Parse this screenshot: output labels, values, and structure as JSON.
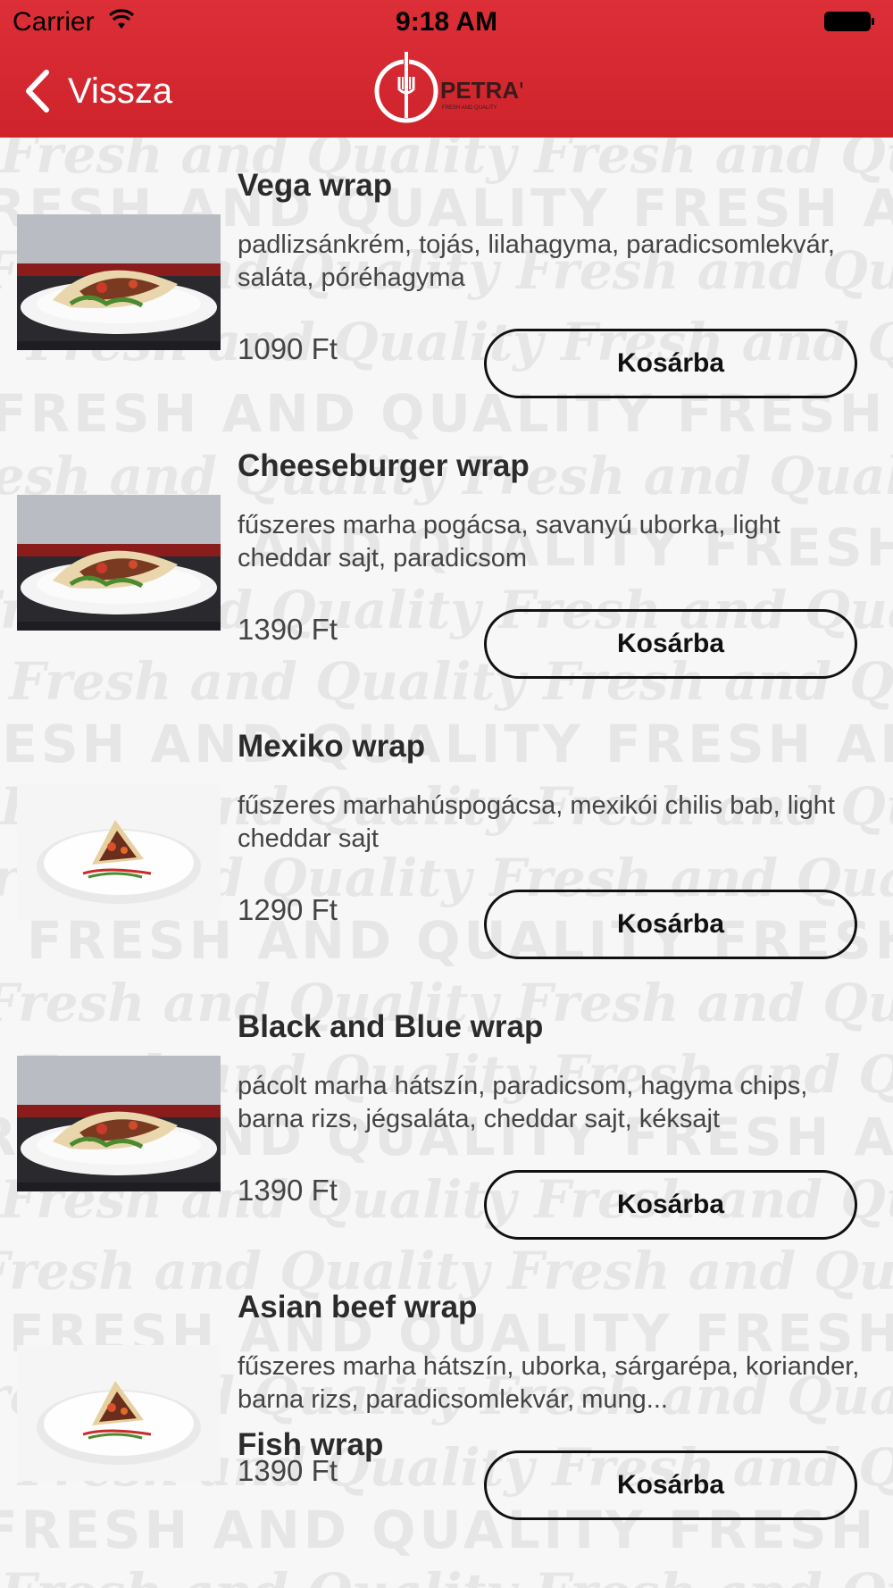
{
  "status_bar": {
    "carrier": "Carrier",
    "time": "9:18 AM"
  },
  "nav": {
    "back_label": "Vissza",
    "logo_text": "PETRA'Z",
    "logo_tagline": "FRESH AND QUALITY"
  },
  "watermark_text": [
    "Fresh and Quality",
    "FRESH AND QUALITY"
  ],
  "products": [
    {
      "name": "Vega wrap",
      "description": "padlizsánkrém, tojás, lilahagyma, paradicsomlekvár, saláta, póréhagyma",
      "price": "1090 Ft",
      "cart_label": "Kosárba",
      "photo_style": "dark-backdrop"
    },
    {
      "name": "Cheeseburger wrap",
      "description": "fűszeres marha pogácsa, savanyú uborka, light cheddar sajt, paradicsom",
      "price": "1390 Ft",
      "cart_label": "Kosárba",
      "photo_style": "dark-backdrop"
    },
    {
      "name": "Mexiko wrap",
      "description": "fűszeres marhahúspogácsa, mexikói chilis bab, light cheddar sajt",
      "price": "1290 Ft",
      "cart_label": "Kosárba",
      "photo_style": "white-plate"
    },
    {
      "name": "Black and Blue wrap",
      "description": "pácolt marha hátszín, paradicsom, hagyma chips, barna rizs, jégsaláta, cheddar sajt, kéksajt",
      "price": "1390 Ft",
      "cart_label": "Kosárba",
      "photo_style": "dark-backdrop"
    },
    {
      "name": "Asian beef wrap",
      "description": "fűszeres marha hátszín, uborka, sárgarépa, koriander, barna rizs, paradicsomlekvár, mung...",
      "price": "1390 Ft",
      "cart_label": "Kosárba",
      "photo_style": "white-plate"
    }
  ],
  "partial_item": {
    "name": "Fish wrap"
  },
  "colors": {
    "header": "#d4252e",
    "button_border": "#111111",
    "background": "#f7f7f7"
  }
}
